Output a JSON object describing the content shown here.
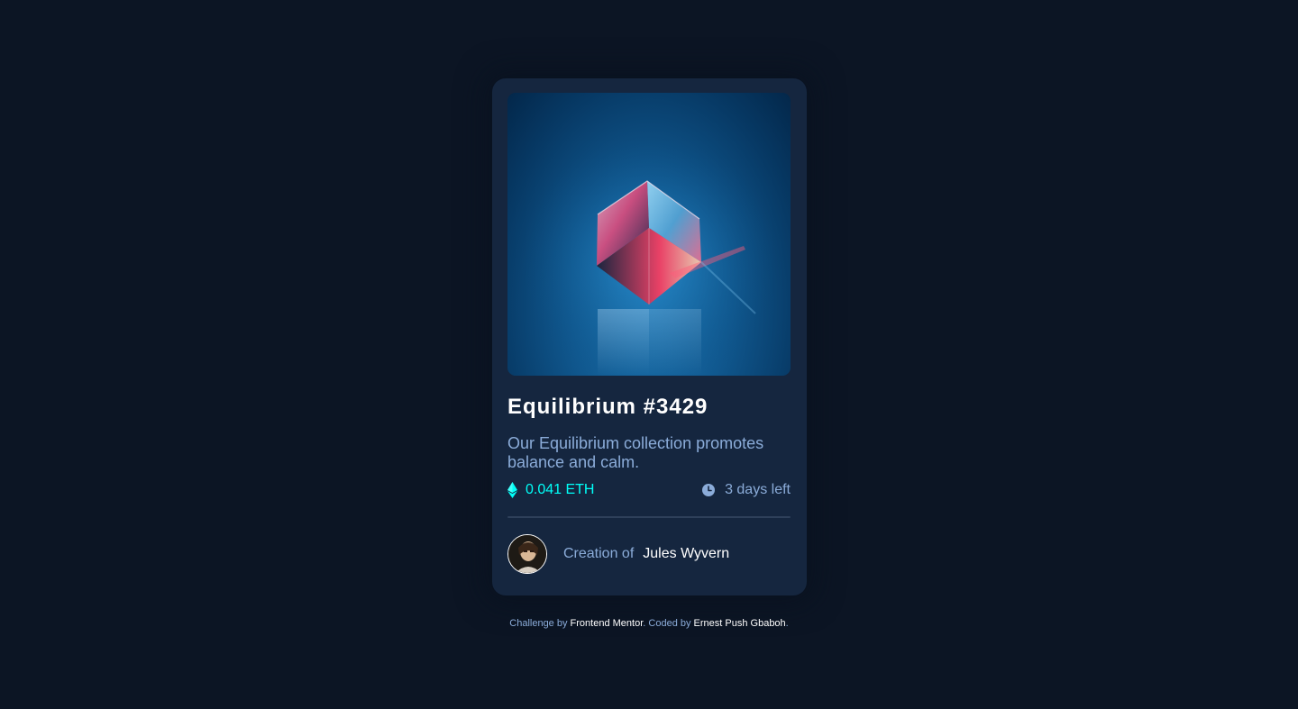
{
  "card": {
    "title": "Equilibrium #3429",
    "description": "Our Equilibrium collection promotes balance and calm.",
    "price": "0.041 ETH",
    "time_left": "3 days left",
    "creator_label": "Creation of",
    "creator_name": "Jules Wyvern"
  },
  "icons": {
    "price": "ethereum-icon",
    "time": "clock-icon"
  },
  "attribution": {
    "challenge_prefix": "Challenge by",
    "challenge_link": "Frontend Mentor",
    "sep1": ". ",
    "coded_prefix": "Coded by",
    "coded_link": "Ernest Push Gbaboh",
    "end": "."
  },
  "colors": {
    "page_bg": "#0c1524",
    "card_bg": "#15263f",
    "accent_cyan": "#00fff8",
    "soft_blue": "#8bacd9",
    "white": "#ffffff",
    "divider": "#2e405a"
  }
}
